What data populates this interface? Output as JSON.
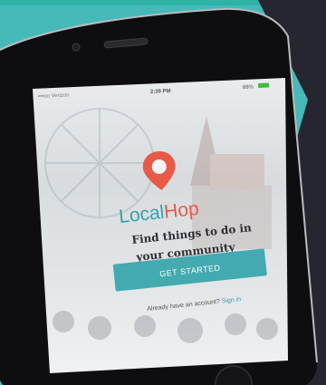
{
  "status_bar": {
    "carrier": "•••oo Verizon",
    "time": "2:39 PM",
    "battery": "88%"
  },
  "app": {
    "logo_local": "Local",
    "logo_hop": "Hop",
    "tagline_line1": "Find things to do in",
    "tagline_line2": "your community",
    "cta_label": "GET STARTED",
    "signin_prompt": "Already have an account?",
    "signin_link": "Sign in"
  },
  "colors": {
    "background": "#46b9b9",
    "dark_panel": "#262630",
    "accent_teal": "#3aa6ad",
    "brand_red": "#e85a47",
    "brand_teal": "#35a0ad"
  },
  "icons": {
    "logo": "map-pin-icon"
  }
}
